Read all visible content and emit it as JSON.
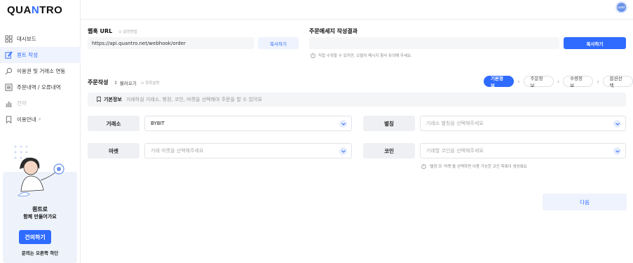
{
  "brand": {
    "logo_text": "QUANTRO"
  },
  "user": {
    "avatar_text": "user"
  },
  "sidebar": {
    "items": [
      {
        "label": "대시보드",
        "icon": "dashboard-icon",
        "state": "normal"
      },
      {
        "label": "퀀트 작성",
        "icon": "edit-icon",
        "state": "active"
      },
      {
        "label": "이용권 및 거래소 연동",
        "icon": "key-icon",
        "state": "normal"
      },
      {
        "label": "주문내역 / 오류내역",
        "icon": "list-icon",
        "state": "normal"
      },
      {
        "label": "전략",
        "icon": "chart-icon",
        "state": "disabled"
      },
      {
        "label": "이용안내",
        "icon": "bookmark-icon",
        "state": "normal",
        "suffix": "↗"
      }
    ],
    "promo": {
      "title": "퀀트로",
      "subtitle": "함께 만들어가요",
      "button": "건의하기",
      "footer": "문의는 오른쪽 하단"
    }
  },
  "webhook": {
    "label": "웹훅 URL",
    "hint": "설정방법",
    "url": "https://api.quantro.net/webhook/order",
    "copy": "복사하기"
  },
  "message": {
    "label": "주문메세지 작성결과",
    "value": "",
    "copy": "복사하기",
    "note": "직접 수정할 수 있지만, 오탈이 메시지 형식 유의해 주세요."
  },
  "order": {
    "title": "주문작성",
    "load": "불러오기",
    "hint": "항목설명",
    "steps": [
      "기본정보",
      "주문정보",
      "수량정보",
      "옵션선택"
    ],
    "active_step": 0
  },
  "info": {
    "title": "기본정보",
    "desc": "거래하실 거래소, 병정, 코인, 마켓을 선택해야 주문을 할 수 있어요"
  },
  "form": {
    "exchange": {
      "label": "거래소",
      "value": "BYBIT"
    },
    "nickname": {
      "label": "별칭",
      "placeholder": "거래소 별칭을 선택해주세요"
    },
    "market": {
      "label": "마켓",
      "placeholder": "거래 마켓을 선택해주세요"
    },
    "coin": {
      "label": "코인",
      "placeholder": "거래할 코인을 선택해주세요"
    },
    "coin_note": "'별칭'과 '마켓'을 선택하면 이용 가능한 코인 목록이 생성돼요"
  },
  "next": "다음",
  "colors": {
    "accent": "#2f6bff",
    "light": "#eef3fd",
    "field": "#f5f6f8"
  }
}
